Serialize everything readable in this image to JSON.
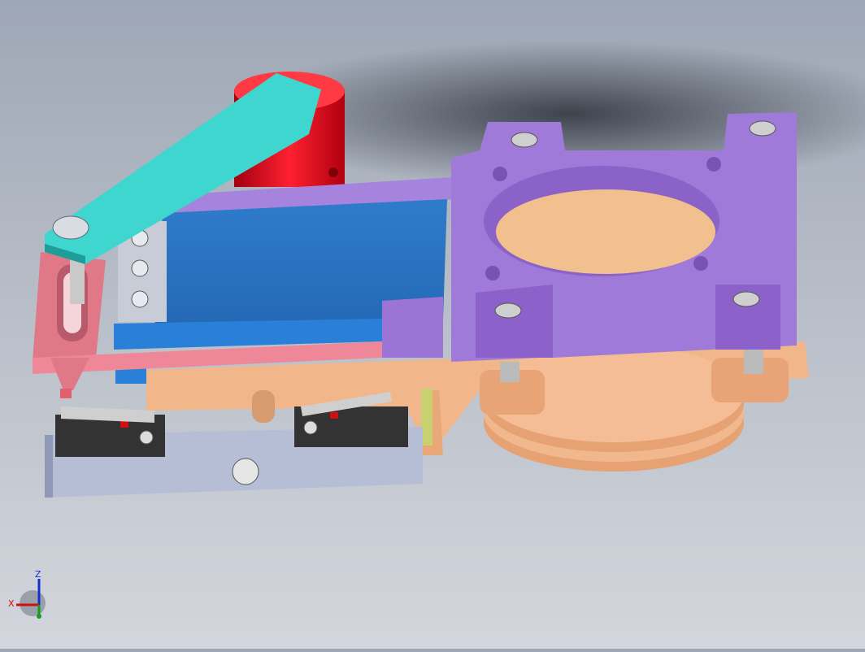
{
  "viewport": {
    "background_top": "#9ea7b6",
    "background_bottom": "#d3d6dc"
  },
  "model": {
    "parts": [
      {
        "name": "motor-housing",
        "color": "#e0101c"
      },
      {
        "name": "crank-arm",
        "color": "#3dd3cc"
      },
      {
        "name": "gate-plate",
        "color": "#2a78c8"
      },
      {
        "name": "valve-body",
        "color": "#a57ad9"
      },
      {
        "name": "base-frame",
        "color": "#f0b888"
      },
      {
        "name": "link-bracket",
        "color": "#e38a98"
      },
      {
        "name": "switch-mount",
        "color": "#b9c1d7"
      },
      {
        "name": "limit-switch",
        "color": "#333333"
      }
    ]
  },
  "triad": {
    "z_label": "Z",
    "x_label": "X",
    "x_color": "#d01010",
    "y_color": "#10a020",
    "z_color": "#1030d0"
  }
}
